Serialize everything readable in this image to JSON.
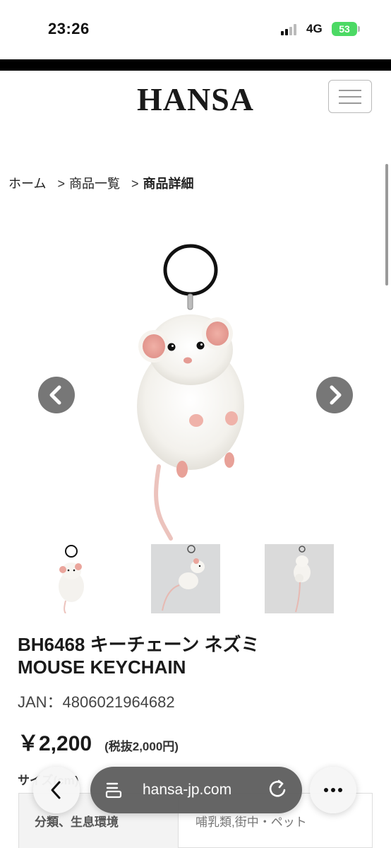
{
  "status_bar": {
    "time": "23:26",
    "network": "4G",
    "battery": "53"
  },
  "header": {
    "logo": "HANSA",
    "menu_icon": "hamburger-menu-icon"
  },
  "breadcrumb": {
    "items": [
      "ホーム",
      "商品一覧",
      "商品詳細"
    ],
    "separator": ">"
  },
  "gallery": {
    "prev_icon": "chevron-left-icon",
    "next_icon": "chevron-right-icon",
    "thumbnail_count": 3
  },
  "product": {
    "title_line1": "BH6468 キーチェーン ネズミ",
    "title_line2": "MOUSE KEYCHAIN",
    "jan": "JAN：4806021964682",
    "price": "￥2,200",
    "tax_note": "(税抜2,000円)",
    "size_label": "サイズ(cm)"
  },
  "specs": [
    {
      "label": "分類、生息環境",
      "value": "哺乳類,街中・ペット"
    }
  ],
  "browser_bar": {
    "url": "hansa-jp.com",
    "back_icon": "back-chevron-icon",
    "tabs_icon": "page-tabs-icon",
    "reload_icon": "reload-icon",
    "more_icon": "more-dots-icon"
  },
  "colors": {
    "accent_battery": "#4cd964",
    "arrow_button": "#777777"
  }
}
